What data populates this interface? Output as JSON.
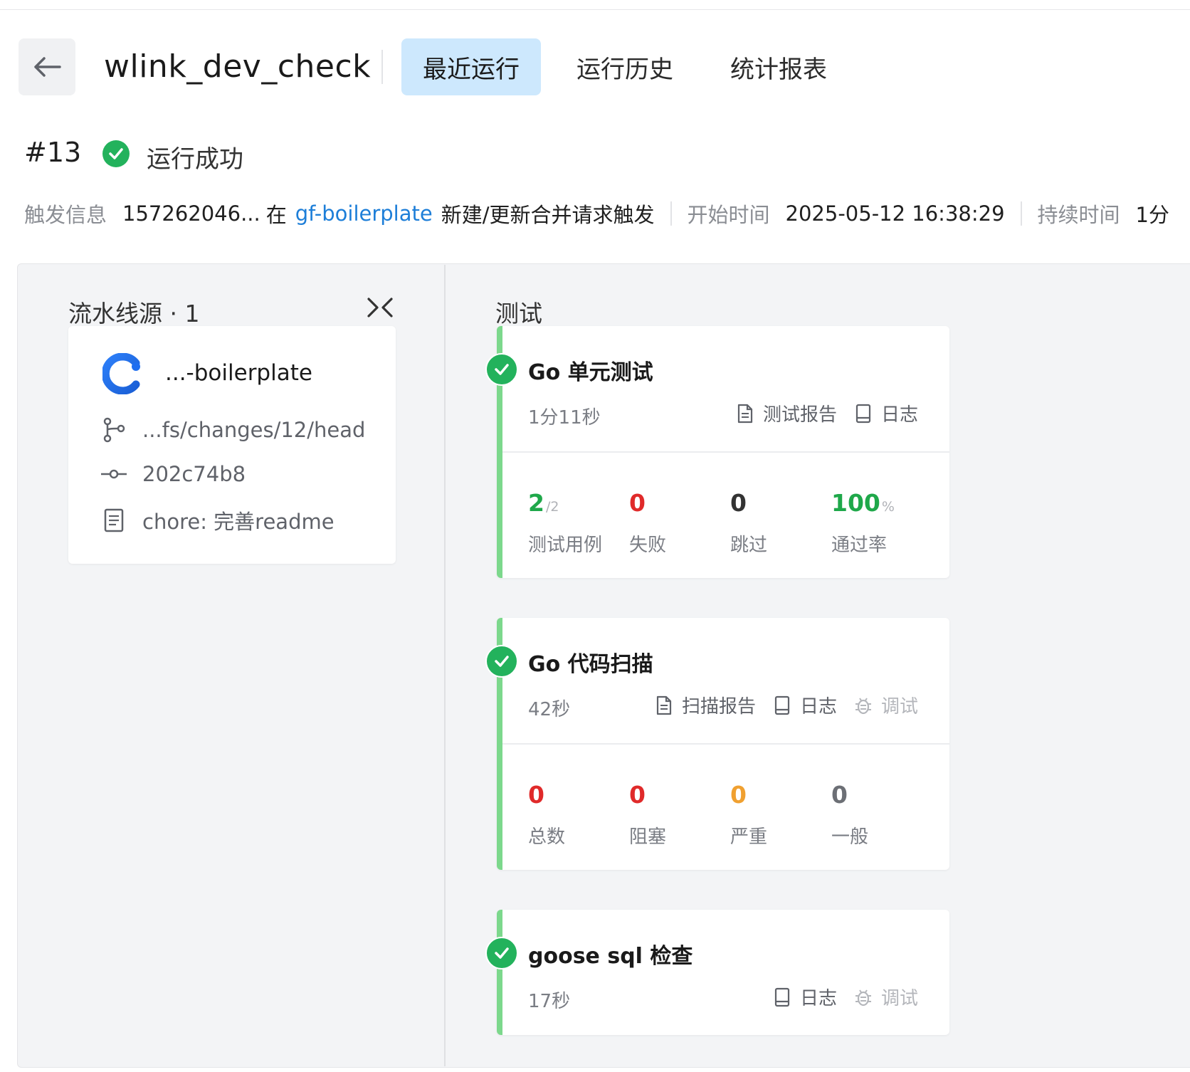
{
  "header": {
    "title": "wlink_dev_check",
    "tabs": [
      {
        "label": "最近运行",
        "active": true
      },
      {
        "label": "运行历史",
        "active": false
      },
      {
        "label": "统计报表",
        "active": false
      }
    ]
  },
  "run": {
    "number": "#13",
    "status": "运行成功",
    "trigger_label": "触发信息",
    "trigger_user": "157262046...",
    "trigger_in": "在",
    "trigger_repo": "gf-boilerplate",
    "trigger_event": "新建/更新合并请求触发",
    "start_label": "开始时间",
    "start_value": "2025-05-12 16:38:29",
    "duration_label": "持续时间",
    "duration_value": "1分"
  },
  "source_panel": {
    "title": "流水线源 · 1",
    "repo": "...-boilerplate",
    "ref": "...fs/changes/12/head",
    "commit": "202c74b8",
    "message": "chore: 完善readme"
  },
  "stage": {
    "title": "测试",
    "jobs": [
      {
        "title": "Go 单元测试",
        "duration": "1分11秒",
        "actions": [
          "测试报告",
          "日志"
        ],
        "stats": [
          {
            "value": "2",
            "suffix": "/2",
            "label": "测试用例"
          },
          {
            "value": "0",
            "label": "失败"
          },
          {
            "value": "0",
            "label": "跳过"
          },
          {
            "value": "100",
            "suffix": "%",
            "label": "通过率"
          }
        ]
      },
      {
        "title": "Go 代码扫描",
        "duration": "42秒",
        "actions": [
          "扫描报告",
          "日志",
          "调试"
        ],
        "stats": [
          {
            "value": "0",
            "label": "总数"
          },
          {
            "value": "0",
            "label": "阻塞"
          },
          {
            "value": "0",
            "label": "严重"
          },
          {
            "value": "0",
            "label": "一般"
          }
        ]
      },
      {
        "title": "goose sql 检查",
        "duration": "17秒",
        "actions": [
          "日志",
          "调试"
        ]
      }
    ]
  },
  "colors": {
    "success": "#23b25c",
    "tab_active_bg": "#cde8fd",
    "link": "#1d7ed8",
    "job_bar": "#7cd88c",
    "red": "#e02a2a",
    "orange": "#f0a030"
  },
  "icons": [
    "back-arrow-icon",
    "success-check-icon",
    "collapse-icon",
    "repo-logo-icon",
    "branch-icon",
    "commit-icon",
    "message-icon",
    "report-icon",
    "log-icon",
    "debug-icon"
  ]
}
